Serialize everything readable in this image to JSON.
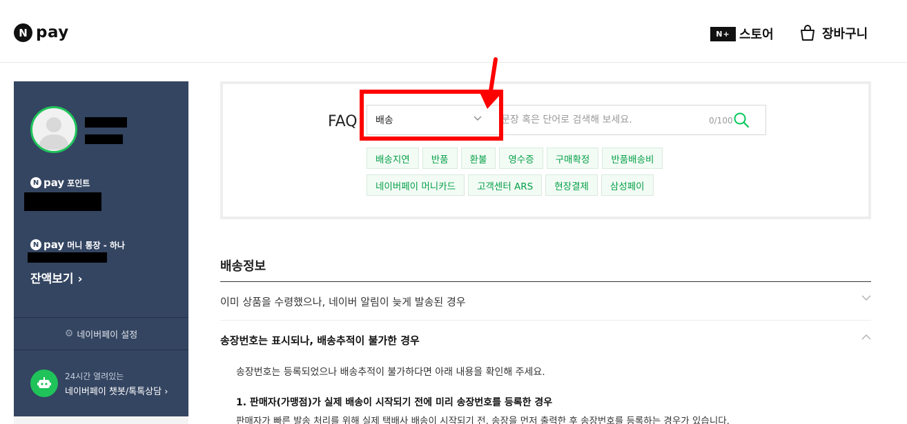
{
  "header": {
    "logo_n": "N",
    "logo_text": "pay",
    "store_badge": "N+",
    "store_label": "스토어",
    "cart_label": "장바구니"
  },
  "sidebar": {
    "points_label": "포인트",
    "account_label": "머니 통장 - 하나",
    "balance_label": "잔액보기",
    "settings_label": "네이버페이 설정",
    "chatbot_line1": "24시간 열려있는",
    "chatbot_line2": "네이버페이 챗봇/톡톡상담"
  },
  "faq": {
    "title": "FAQ",
    "category_selected": "배송",
    "search_placeholder": "문장 혹은 단어로 검색해 보세요.",
    "search_value": "",
    "counter": "0/100",
    "tags_row1": [
      "배송지연",
      "반품",
      "환불",
      "영수증",
      "구매확정",
      "반품배송비"
    ],
    "tags_row2": [
      "네이버페이 머니카드",
      "고객센터 ARS",
      "현장결제",
      "삼성페이"
    ]
  },
  "content": {
    "section_title": "배송정보",
    "items": [
      "이미 상품을 수령했으나, 네이버 알림이 늦게 발송된 경우",
      "송장번호는 표시되나, 배송추적이 불가한 경우"
    ],
    "answer_intro": "송장번호는 등록되었으나 배송추적이 불가하다면 아래 내용을 확인해 주세요.",
    "answer_heading": "1. 판매자(가맹점)가 실제 배송이 시작되기 전에 미리 송장번호를 등록한 경우",
    "answer_body": "판매자가 빠른 발송 처리를 위해 실제 택배사 배송이 시작되기 전, 송장을 먼저 출력한 후 송장번호를 등록하는 경우가 있습니다."
  },
  "colors": {
    "sidebar_bg": "#344561",
    "accent_green": "#03a046",
    "highlight_red": "#ff0000"
  }
}
